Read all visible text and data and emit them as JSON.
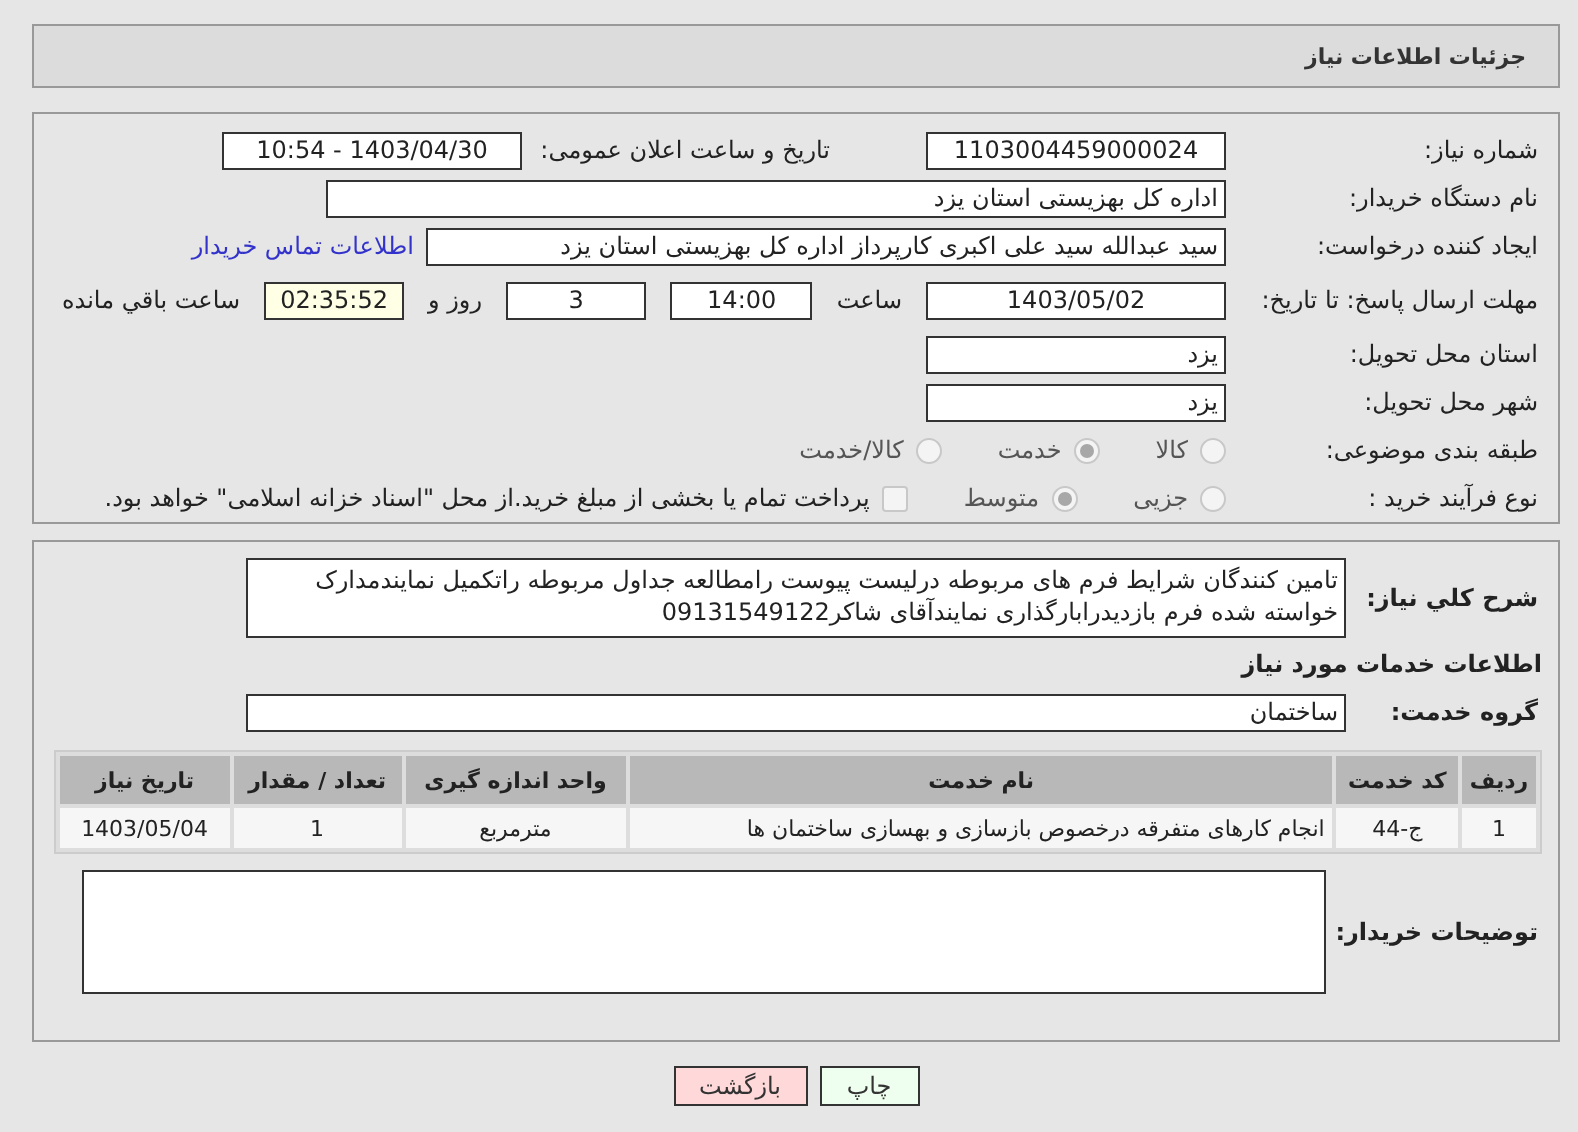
{
  "header": {
    "title": "جزئیات اطلاعات نیاز"
  },
  "details": {
    "need_number": {
      "label": "شماره نیاز:",
      "value": "1103004459000024"
    },
    "announce": {
      "label": "تاریخ و ساعت اعلان عمومی:",
      "value": "1403/04/30 - 10:54"
    },
    "buyer": {
      "label": "نام دستگاه خریدار:",
      "value": "اداره کل بهزیستی استان یزد"
    },
    "creator": {
      "label": "ایجاد کننده درخواست:",
      "value": "سید عبدالله سید علی اکبری کارپرداز اداره کل بهزیستی استان یزد",
      "link": "اطلاعات تماس خریدار"
    },
    "deadline": {
      "label": "مهلت ارسال پاسخ: تا تاریخ:",
      "date": "1403/05/02",
      "time_label": "ساعت",
      "time": "14:00",
      "days": "3",
      "days_label": "روز و",
      "remaining": "02:35:52",
      "remaining_label": "ساعت باقي مانده"
    },
    "province": {
      "label": "استان محل تحویل:",
      "value": "یزد"
    },
    "city": {
      "label": "شهر محل تحویل:",
      "value": "یزد"
    },
    "category": {
      "label": "طبقه بندی موضوعی:",
      "options": [
        {
          "label": "کالا",
          "selected": false
        },
        {
          "label": "خدمت",
          "selected": true
        },
        {
          "label": "کالا/خدمت",
          "selected": false
        }
      ]
    },
    "process": {
      "label": "نوع فرآیند خرید :",
      "options": [
        {
          "label": "جزیی",
          "selected": false
        },
        {
          "label": "متوسط",
          "selected": true
        }
      ],
      "treasury": {
        "label": "پرداخت تمام یا بخشی از مبلغ خرید.از محل \"اسناد خزانه اسلامی\" خواهد بود.",
        "checked": false
      }
    }
  },
  "description": {
    "label": "شرح كلي نیاز:",
    "value": "تامین کنندگان شرایط فرم های مربوطه درلیست پیوست رامطالعه جداول مربوطه راتکمیل نمایندمدارک خواسته شده فرم بازدیدرابارگذاری نمایندآقای شاکر09131549122"
  },
  "services": {
    "title": "اطلاعات خدمات مورد نیاز",
    "group_label": "گروه خدمت:",
    "group": "ساختمان",
    "columns": [
      "ردیف",
      "کد خدمت",
      "نام خدمت",
      "واحد اندازه گیری",
      "تعداد / مقدار",
      "تاریخ نیاز"
    ],
    "rows": [
      [
        "1",
        "ج-44",
        "انجام کارهای متفرقه درخصوص بازسازی و بهسازی ساختمان ها",
        "مترمربع",
        "1",
        "1403/05/04"
      ]
    ]
  },
  "notes": {
    "label": "توضیحات خریدار:"
  },
  "buttons": [
    {
      "label": "چاپ",
      "kind": "print"
    },
    {
      "label": "بازگشت",
      "kind": "back"
    }
  ]
}
